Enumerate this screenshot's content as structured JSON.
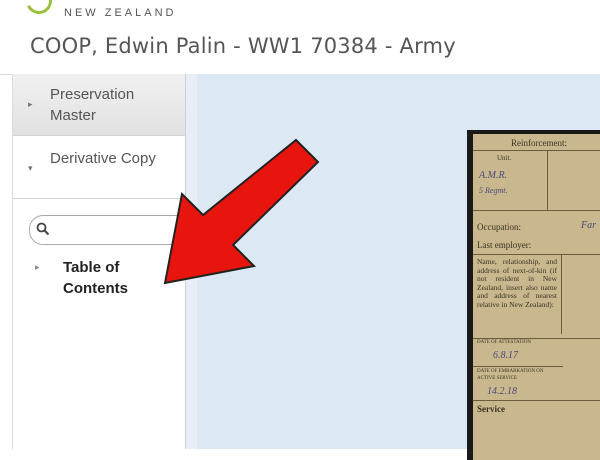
{
  "header": {
    "brand": "NEW ZEALAND",
    "title": "COOP, Edwin Palin - WW1 70384 - Army"
  },
  "sidebar": {
    "preservation_label": "Preservation Master",
    "derivative_label": "Derivative Copy",
    "toc_label": "Table of Contents",
    "search_placeholder": ""
  },
  "document": {
    "reinforcement": "Reinforcement:",
    "unit": "Unit.",
    "hand_unit": "A.M.R.",
    "hand_unit2": "5 Regmt.",
    "occupation": "Occupation:",
    "hand_occupation": "Far",
    "last_employer": "Last employer:",
    "next_of_kin": "Name, relationship, and address of next-of-kin (if not resident in New Zealand, insert also name and address of nearest relative in New Zealand):",
    "date_attestation": "DATE OF ATTESTATION",
    "hand_date1": "6.8.17",
    "date_embark": "DATE OF EMBARKATION ON ACTIVE SERVICE",
    "hand_date2": "14.2.18",
    "service": "Service"
  },
  "colors": {
    "annotation_arrow": "#e8150f",
    "viewer_bg": "#dce8f4",
    "logo_green": "#9ac13d"
  }
}
